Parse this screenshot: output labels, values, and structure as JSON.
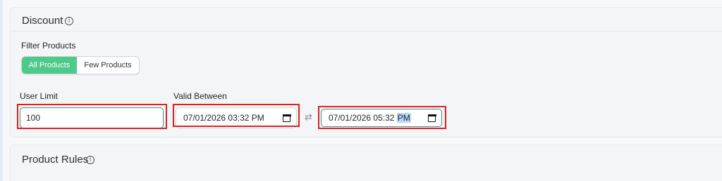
{
  "discount_section": {
    "title": "Discount",
    "info_icon": "info-icon",
    "filter_label": "Filter Products",
    "filter_options": [
      {
        "label": "All Products",
        "selected": true
      },
      {
        "label": "Few Products",
        "selected": false
      }
    ],
    "user_limit": {
      "label": "User Limit",
      "value": "100"
    },
    "valid_between": {
      "label": "Valid Between",
      "start": {
        "date": "07/01/2026",
        "time": "03:32",
        "ampm": "PM"
      },
      "end": {
        "date": "07/01/2026",
        "time": "05:32",
        "ampm": "PM"
      },
      "swap_icon": "swap-arrows-icon",
      "calendar_icon": "calendar-icon"
    }
  },
  "product_rules_section": {
    "title": "Product Rules",
    "info_icon": "info-icon"
  },
  "colors": {
    "accent_green": "#4ec98a",
    "highlight_red": "#e02020",
    "focus_border": "#3f8f9a",
    "selection": "#b9d6fb"
  }
}
